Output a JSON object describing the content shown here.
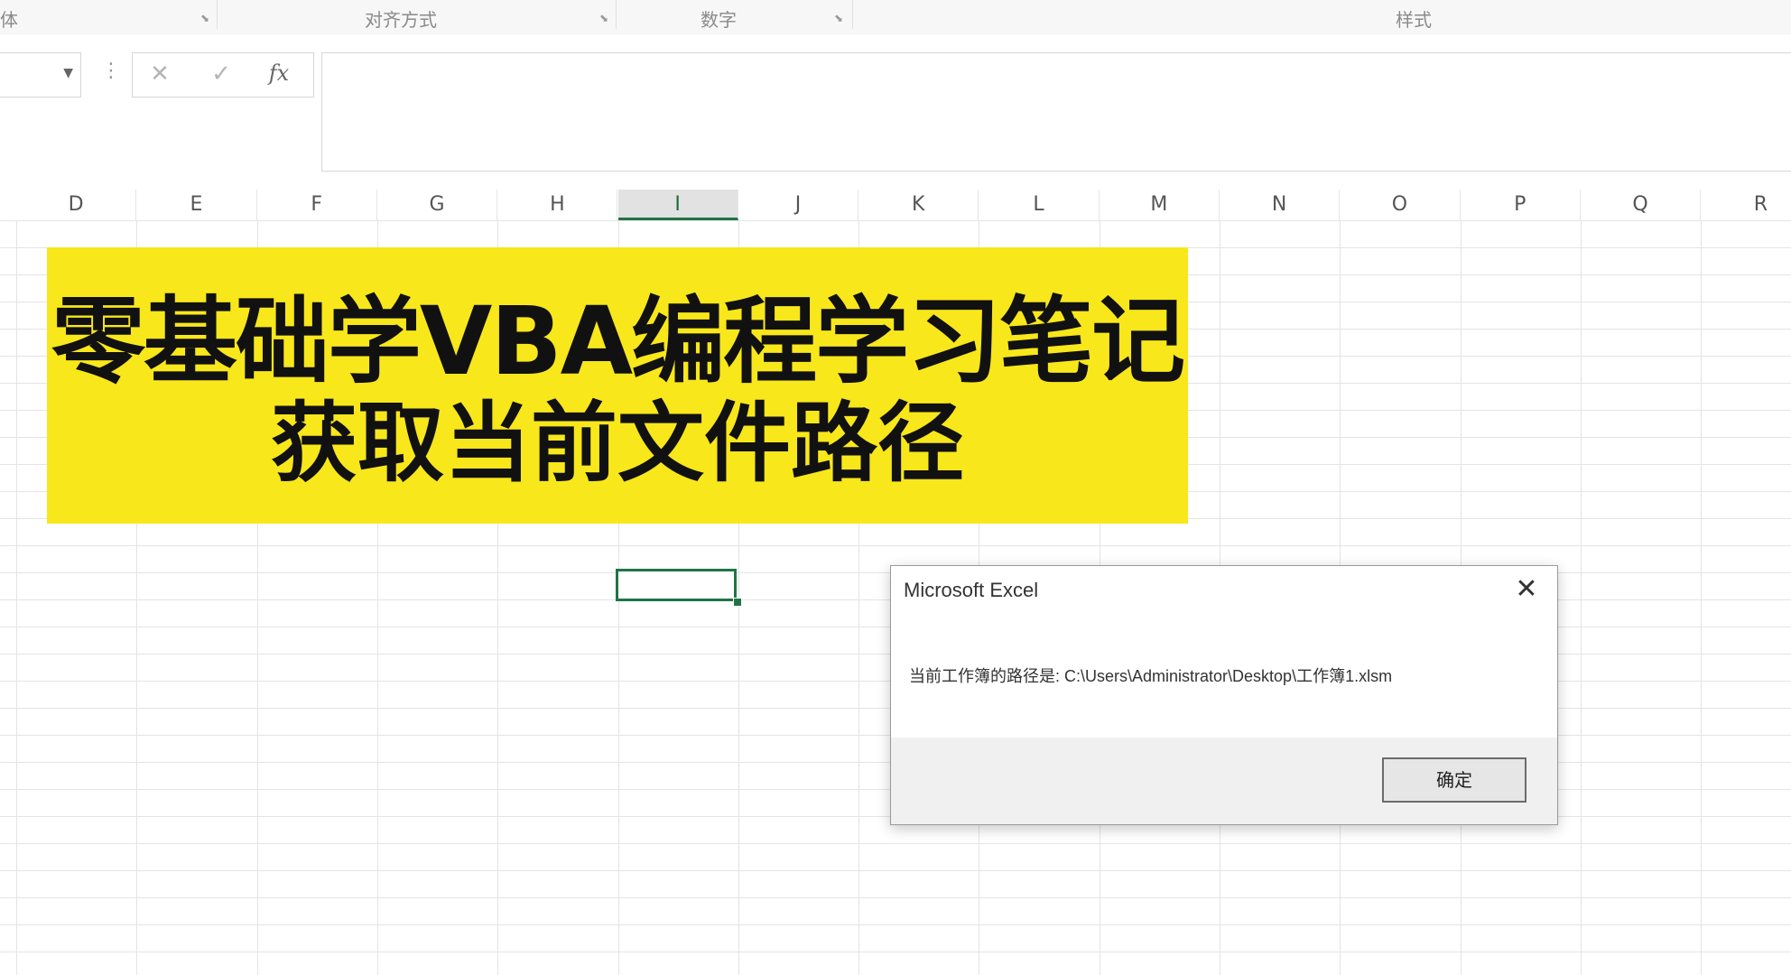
{
  "ribbon": {
    "groups": [
      {
        "label": "体"
      },
      {
        "label": "对齐方式"
      },
      {
        "label": "数字"
      },
      {
        "label": "样式"
      }
    ]
  },
  "formula_bar": {
    "cancel_icon": "close-icon",
    "enter_icon": "checkmark-icon",
    "fx_label": "fx",
    "value": ""
  },
  "columns": [
    "D",
    "E",
    "F",
    "G",
    "H",
    "I",
    "J",
    "K",
    "L",
    "M",
    "N",
    "O",
    "P",
    "Q",
    "R"
  ],
  "selected_column": "I",
  "banner": {
    "line1": "零基础学VBA编程学习笔记",
    "line2": "获取当前文件路径",
    "color": "#f8e71a"
  },
  "dialog": {
    "title": "Microsoft Excel",
    "message": "当前工作簿的路径是:  C:\\Users\\Administrator\\Desktop\\工作簿1.xlsm",
    "ok_label": "确定",
    "close_icon": "close-icon"
  },
  "colors": {
    "accent": "#217346"
  }
}
